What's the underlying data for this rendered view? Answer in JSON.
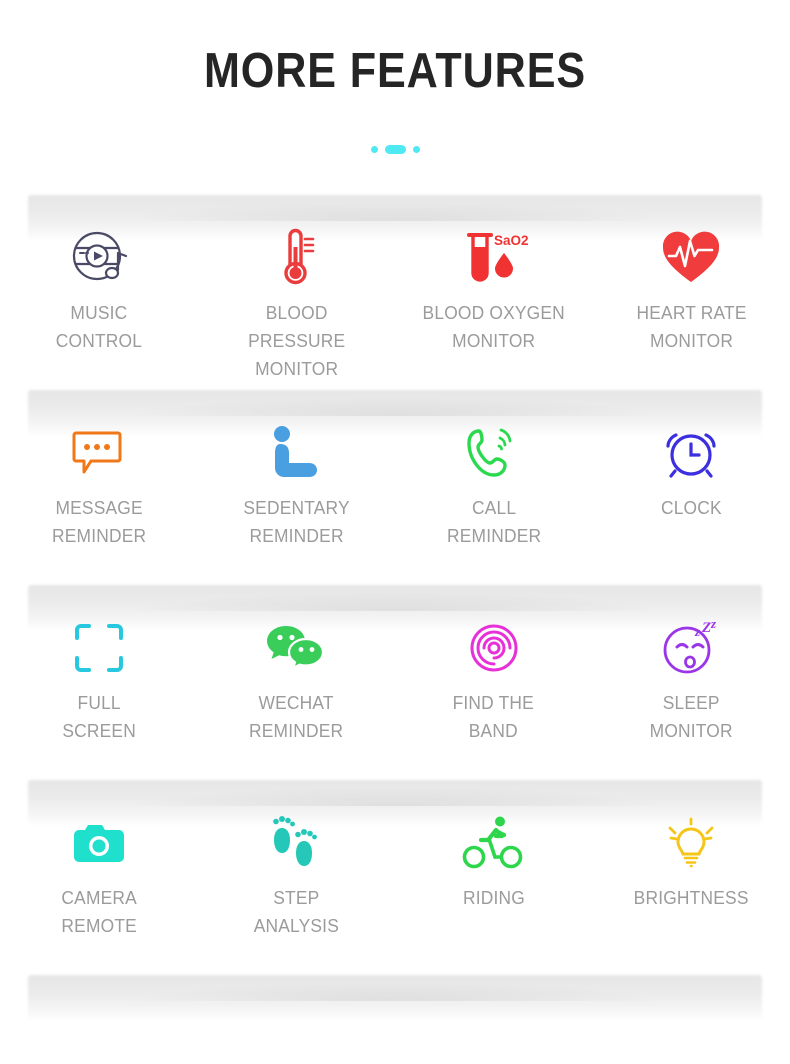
{
  "header": {
    "title": "MORE FEATURES",
    "divider_color": "#4fe9f2"
  },
  "label_color": "#9b9b9b",
  "rows": [
    {
      "cells": [
        {
          "icon": "music-disc-icon",
          "icon_color": "#4a4a66",
          "label": "MUSIC\nCONTROL"
        },
        {
          "icon": "thermometer-icon",
          "icon_color": "#ea3c3c",
          "label": "BLOOD\nPRESSURE\nMONITOR"
        },
        {
          "icon": "test-tube-sao2-icon",
          "icon_color": "#f03232",
          "label": "BLOOD OXYGEN\nMONITOR",
          "badge": "SaO2"
        },
        {
          "icon": "heart-pulse-icon",
          "icon_color": "#f03c3c",
          "label": "HEART RATE\nMONITOR"
        }
      ]
    },
    {
      "cells": [
        {
          "icon": "message-bubble-icon",
          "icon_color": "#f07818",
          "label": "MESSAGE\nREMINDER"
        },
        {
          "icon": "sedentary-person-icon",
          "icon_color": "#4a9fe0",
          "label": "SEDENTARY\nREMINDER"
        },
        {
          "icon": "phone-call-icon",
          "icon_color": "#2bd94e",
          "label": "CALL\nREMINDER"
        },
        {
          "icon": "alarm-clock-icon",
          "icon_color": "#3b2fe0",
          "label": "CLOCK"
        }
      ]
    },
    {
      "cells": [
        {
          "icon": "fullscreen-brackets-icon",
          "icon_color": "#28c8e0",
          "label": "FULL\nSCREEN"
        },
        {
          "icon": "wechat-bubbles-icon",
          "icon_color": "#3acd5a",
          "label": "WECHAT\nREMINDER"
        },
        {
          "icon": "spiral-rings-icon",
          "icon_color": "#e830d8",
          "label": "FIND THE\nBAND"
        },
        {
          "icon": "sleeping-face-icon",
          "icon_color": "#9a35e8",
          "label": "SLEEP\nMONITOR"
        }
      ]
    },
    {
      "cells": [
        {
          "icon": "camera-icon",
          "icon_color": "#1ee0cd",
          "label": "CAMERA\nREMOTE"
        },
        {
          "icon": "footprints-icon",
          "icon_color": "#25c8b8",
          "label": "STEP\nANALYSIS"
        },
        {
          "icon": "cyclist-icon",
          "icon_color": "#2dd64a",
          "label": "RIDING"
        },
        {
          "icon": "lightbulb-icon",
          "icon_color": "#f5c518",
          "label": "BRIGHTNESS"
        }
      ]
    }
  ]
}
